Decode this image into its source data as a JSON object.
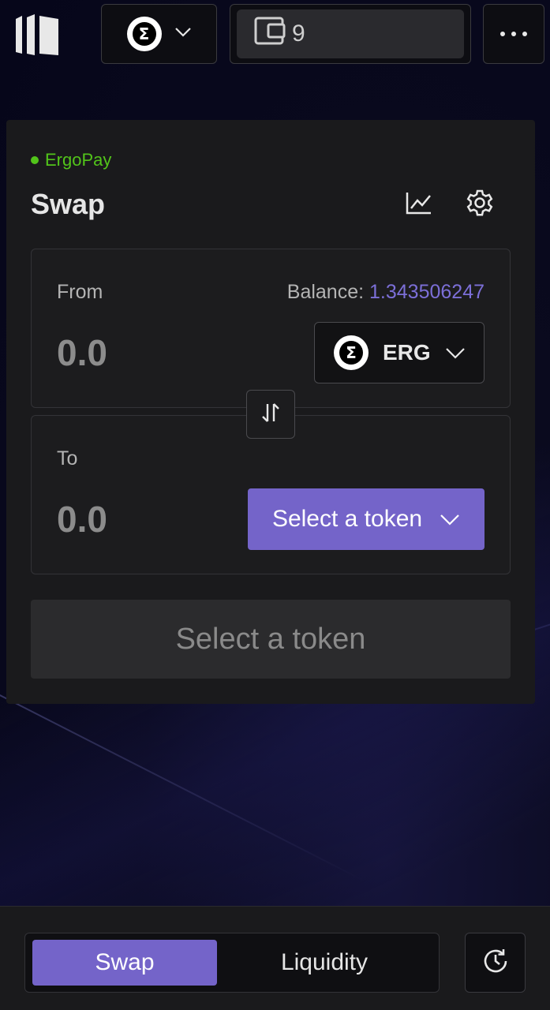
{
  "header": {
    "network_icon": "ergo-sigma-icon",
    "network_symbol": "Σ",
    "wallet_count": "9",
    "menu_icon": "more-horizontal-icon"
  },
  "card": {
    "payment_method": "ErgoPay",
    "title": "Swap",
    "from": {
      "label": "From",
      "balance_label": "Balance:",
      "balance_value": "1.343506247",
      "amount": "0.0",
      "token": "ERG",
      "token_symbol": "Σ"
    },
    "to": {
      "label": "To",
      "amount": "0.0",
      "select_label": "Select a token"
    },
    "submit_label": "Select a token"
  },
  "bottom_nav": {
    "tabs": [
      {
        "label": "Swap",
        "active": true
      },
      {
        "label": "Liquidity",
        "active": false
      }
    ]
  },
  "colors": {
    "accent": "#7464c9",
    "balance": "#7c6fd8",
    "status": "#52c41a",
    "card": "#1a1a1c",
    "background": "#07071b"
  }
}
